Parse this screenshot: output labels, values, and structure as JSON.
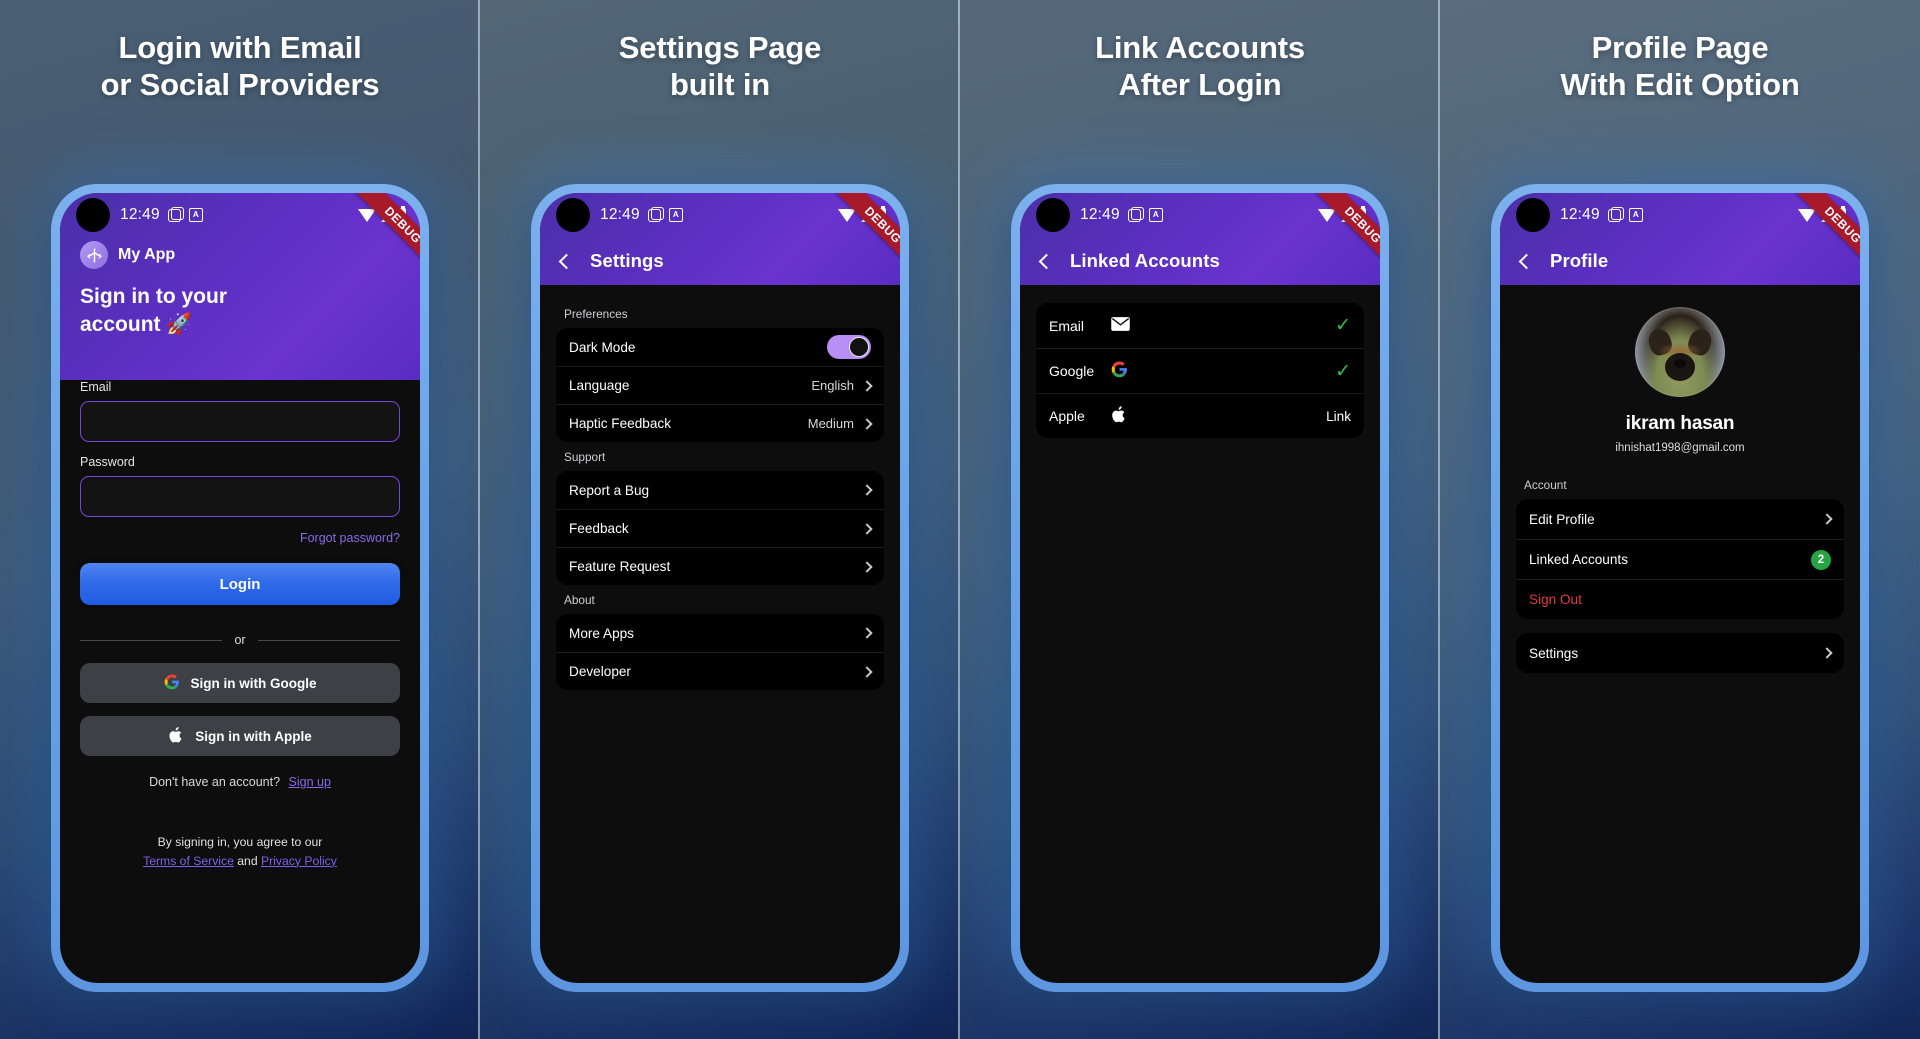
{
  "theme": {
    "accent_purple": "#6a33cf",
    "accent_blue": "#2f6ae8",
    "phone_frame": "#6aa3e8",
    "toggle_on": "#b98ef5",
    "check_green": "#2fbf4f",
    "badge_green": "#27a544",
    "danger_red": "#e13b3b",
    "link_purple": "#7b63e8"
  },
  "panels": [
    {
      "caption_line1": "Login with Email",
      "caption_line2": "or Social Providers",
      "status_bar": {
        "time": "12:49",
        "debug_ribbon": "DEBUG",
        "badge_letter": "A"
      },
      "brand": {
        "name": "My App",
        "logo_icon": "app-logo-icon"
      },
      "hero_title": "Sign in to your account 🚀",
      "form": {
        "email_label": "Email",
        "email_value": "",
        "email_placeholder": "",
        "password_label": "Password",
        "password_value": "",
        "password_placeholder": "",
        "forgot_label": "Forgot password?",
        "login_label": "Login",
        "divider_label": "or",
        "google_label": "Sign in with Google",
        "apple_label": "Sign in with Apple",
        "signup_prompt": "Don't have an account?",
        "signup_link": "Sign up"
      },
      "terms": {
        "line1": "By signing in, you agree to our",
        "tos": "Terms of Service",
        "and": "and",
        "privacy": "Privacy Policy"
      }
    },
    {
      "caption_line1": "Settings Page",
      "caption_line2": "built in",
      "status_bar": {
        "time": "12:49",
        "debug_ribbon": "DEBUG",
        "badge_letter": "A"
      },
      "appbar_title": "Settings",
      "sections": [
        {
          "label": "Preferences",
          "rows": [
            {
              "label": "Dark Mode",
              "control": "toggle",
              "value": "on"
            },
            {
              "label": "Language",
              "control": "value-chevron",
              "value": "English"
            },
            {
              "label": "Haptic Feedback",
              "control": "value-chevron",
              "value": "Medium"
            }
          ]
        },
        {
          "label": "Support",
          "rows": [
            {
              "label": "Report a Bug",
              "control": "chevron",
              "value": ""
            },
            {
              "label": "Feedback",
              "control": "chevron",
              "value": ""
            },
            {
              "label": "Feature Request",
              "control": "chevron",
              "value": ""
            }
          ]
        },
        {
          "label": "About",
          "rows": [
            {
              "label": "More Apps",
              "control": "chevron",
              "value": ""
            },
            {
              "label": "Developer",
              "control": "chevron",
              "value": ""
            }
          ]
        }
      ]
    },
    {
      "caption_line1": "Link Accounts",
      "caption_line2": "After Login",
      "status_bar": {
        "time": "12:49",
        "debug_ribbon": "DEBUG",
        "badge_letter": "A"
      },
      "appbar_title": "Linked Accounts",
      "accounts": [
        {
          "label": "Email",
          "icon": "envelope-icon",
          "status": "linked",
          "action": ""
        },
        {
          "label": "Google",
          "icon": "google-icon",
          "status": "linked",
          "action": ""
        },
        {
          "label": "Apple",
          "icon": "apple-icon",
          "status": "unlinked",
          "action": "Link"
        }
      ]
    },
    {
      "caption_line1": "Profile Page",
      "caption_line2": "With Edit Option",
      "status_bar": {
        "time": "12:49",
        "debug_ribbon": "DEBUG",
        "badge_letter": "A"
      },
      "appbar_title": "Profile",
      "profile": {
        "name": "ikram hasan",
        "email": "ihnishat1998@gmail.com",
        "avatar_alt": "dog-avatar"
      },
      "section_label": "Account",
      "rows": [
        {
          "label": "Edit Profile",
          "control": "chevron",
          "value": ""
        },
        {
          "label": "Linked Accounts",
          "control": "badge",
          "value": "2"
        },
        {
          "label": "Sign Out",
          "control": "none",
          "value": "",
          "style": "danger"
        }
      ],
      "rows2": [
        {
          "label": "Settings",
          "control": "chevron",
          "value": ""
        }
      ]
    }
  ]
}
